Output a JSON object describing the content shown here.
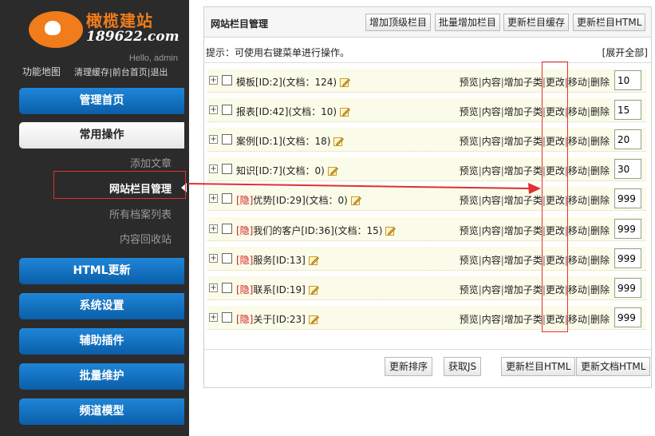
{
  "logo": {
    "title": "橄榄建站",
    "url": "189622.com"
  },
  "sidebar": {
    "hello": "Hello, admin",
    "funcmap": "功能地图",
    "links": [
      "清理缓存",
      "前台首页",
      "退出"
    ],
    "link_sep": "|",
    "nav": {
      "admin_home": "管理首页",
      "common_ops": "常用操作",
      "html_update": "HTML更新",
      "system_settings": "系统设置",
      "plugins": "辅助插件",
      "batch": "批量维护",
      "channel_model": "频道模型"
    },
    "sub_items": [
      "添加文章",
      "网站栏目管理",
      "所有档案列表",
      "内容回收站"
    ]
  },
  "panel": {
    "title": "网站栏目管理",
    "buttons": [
      "增加顶级栏目",
      "批量增加栏目",
      "更新栏目缓存",
      "更新栏目HTML"
    ],
    "hint": "提示：可使用右键菜单进行操作。",
    "expand_all": "[展开全部]",
    "ops": [
      "预览",
      "内容",
      "增加子类",
      "更改",
      "移动",
      "删除"
    ],
    "op_sep": "|",
    "categories": [
      {
        "hidden_tag": "",
        "label": "模板[ID:2](文档：124)",
        "sort": "10"
      },
      {
        "hidden_tag": "",
        "label": "报表[ID:42](文档：10)",
        "sort": "15"
      },
      {
        "hidden_tag": "",
        "label": "案例[ID:1](文档：18)",
        "sort": "20"
      },
      {
        "hidden_tag": "",
        "label": "知识[ID:7](文档：0)",
        "sort": "30"
      },
      {
        "hidden_tag": "[隐]",
        "label": "优势[ID:29](文档：0)",
        "sort": "999"
      },
      {
        "hidden_tag": "[隐]",
        "label": "我们的客户[ID:36](文档：15)",
        "sort": "999"
      },
      {
        "hidden_tag": "[隐]",
        "label": "服务[ID:13]",
        "sort": "999"
      },
      {
        "hidden_tag": "[隐]",
        "label": "联系[ID:19]",
        "sort": "999"
      },
      {
        "hidden_tag": "[隐]",
        "label": "关于[ID:23]",
        "sort": "999"
      }
    ],
    "footer_buttons": [
      "更新排序",
      "获取JS",
      "更新栏目HTML",
      "更新文档HTML"
    ]
  },
  "colors": {
    "nav_blue": "#0a6fc2",
    "logo_orange": "#f07c1c",
    "annotation_red": "#e03030",
    "hidden_tag_red": "#d02020",
    "row_bg": "#fbfbe9"
  }
}
